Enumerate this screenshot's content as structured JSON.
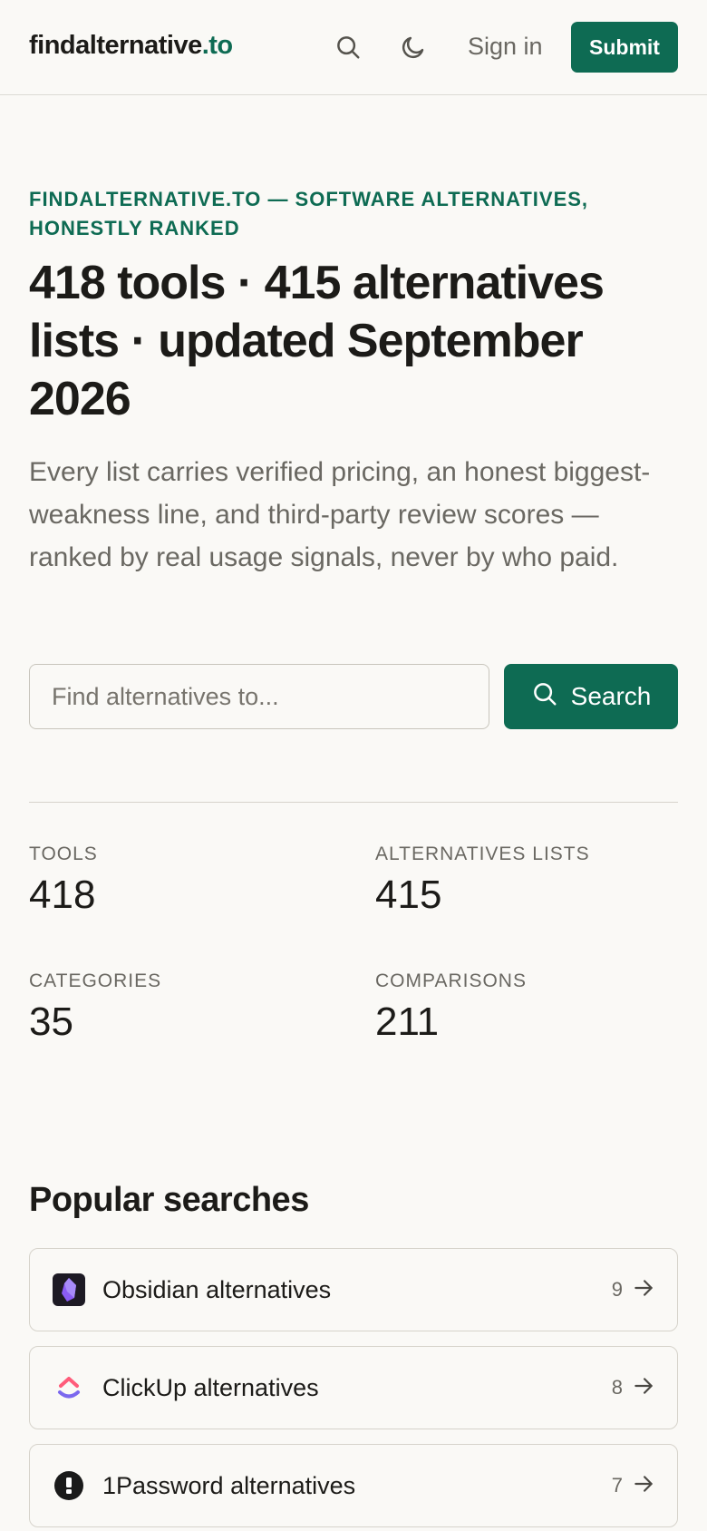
{
  "header": {
    "logo_name": "findalternative",
    "logo_tld": ".to",
    "signin_label": "Sign in",
    "submit_label": "Submit"
  },
  "hero": {
    "eyebrow": "findalternative.to — software alternatives, honestly ranked",
    "headline": "418 tools · 415 alternatives lists · updated September 2026",
    "subtext": "Every list carries verified pricing, an honest biggest-weakness line, and third-party review scores — ranked by real usage signals, never by who paid."
  },
  "search": {
    "placeholder": "Find alternatives to...",
    "button_label": "Search"
  },
  "stats": [
    {
      "label": "Tools",
      "value": "418"
    },
    {
      "label": "Alternatives lists",
      "value": "415"
    },
    {
      "label": "Categories",
      "value": "35"
    },
    {
      "label": "Comparisons",
      "value": "211"
    }
  ],
  "popular": {
    "title": "Popular searches",
    "items": [
      {
        "name": "Obsidian alternatives",
        "count": "9",
        "icon": "obsidian-logo-icon"
      },
      {
        "name": "ClickUp alternatives",
        "count": "8",
        "icon": "clickup-logo-icon"
      },
      {
        "name": "1Password alternatives",
        "count": "7",
        "icon": "1password-logo-icon"
      }
    ]
  },
  "colors": {
    "accent": "#0e6b53",
    "background": "#faf9f6",
    "text": "#1c1b18",
    "muted": "#6a6862"
  }
}
